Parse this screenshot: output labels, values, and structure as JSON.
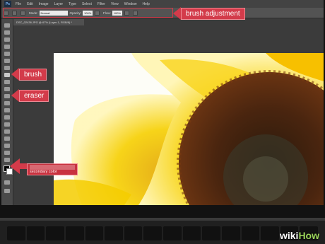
{
  "menubar": {
    "logo": "Ps",
    "items": [
      "File",
      "Edit",
      "Image",
      "Layer",
      "Type",
      "Select",
      "Filter",
      "View",
      "Window",
      "Help"
    ]
  },
  "options": {
    "mode_label": "Mode:",
    "mode_value": "Normal",
    "opacity_label": "Opacity:",
    "opacity_value": "100%",
    "flow_label": "Flow:",
    "flow_value": "100%"
  },
  "document": {
    "tab_title": "DSC_02436.JPG @ 67% (Layer 1, RGB/8) *"
  },
  "callouts": {
    "brush_adjustment": "brush adjustment",
    "brush": "brush",
    "eraser": "eraser",
    "secondary_color": "secondary color"
  },
  "watermark": {
    "wiki": "wiki",
    "how": "How"
  },
  "colors": {
    "accent": "#d33b4a",
    "sunflower_yellow": "#f3c800",
    "sunflower_center": "#3a1c0c"
  }
}
